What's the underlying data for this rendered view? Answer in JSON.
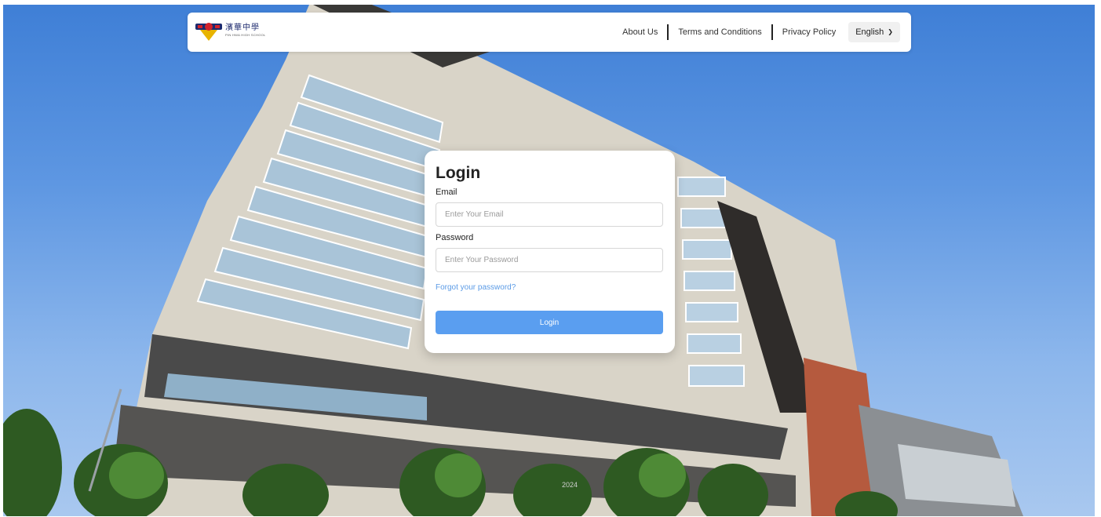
{
  "brand": {
    "name_cn": "濱華中學",
    "name_en": "PIN HWA HIGH SCHOOL"
  },
  "nav": {
    "about": "About Us",
    "terms": "Terms and Conditions",
    "privacy": "Privacy Policy",
    "language": "English"
  },
  "login": {
    "title": "Login",
    "email_label": "Email",
    "email_placeholder": "Enter Your Email",
    "password_label": "Password",
    "password_placeholder": "Enter Your Password",
    "forgot": "Forgot your password?",
    "button": "Login"
  },
  "footer": {
    "year": "2024"
  },
  "colors": {
    "accent": "#5a9ef0",
    "link": "#5b9be6",
    "sky": "#5e97e2"
  },
  "icons": [
    "school-logo-icon",
    "chevron-down-icon"
  ]
}
